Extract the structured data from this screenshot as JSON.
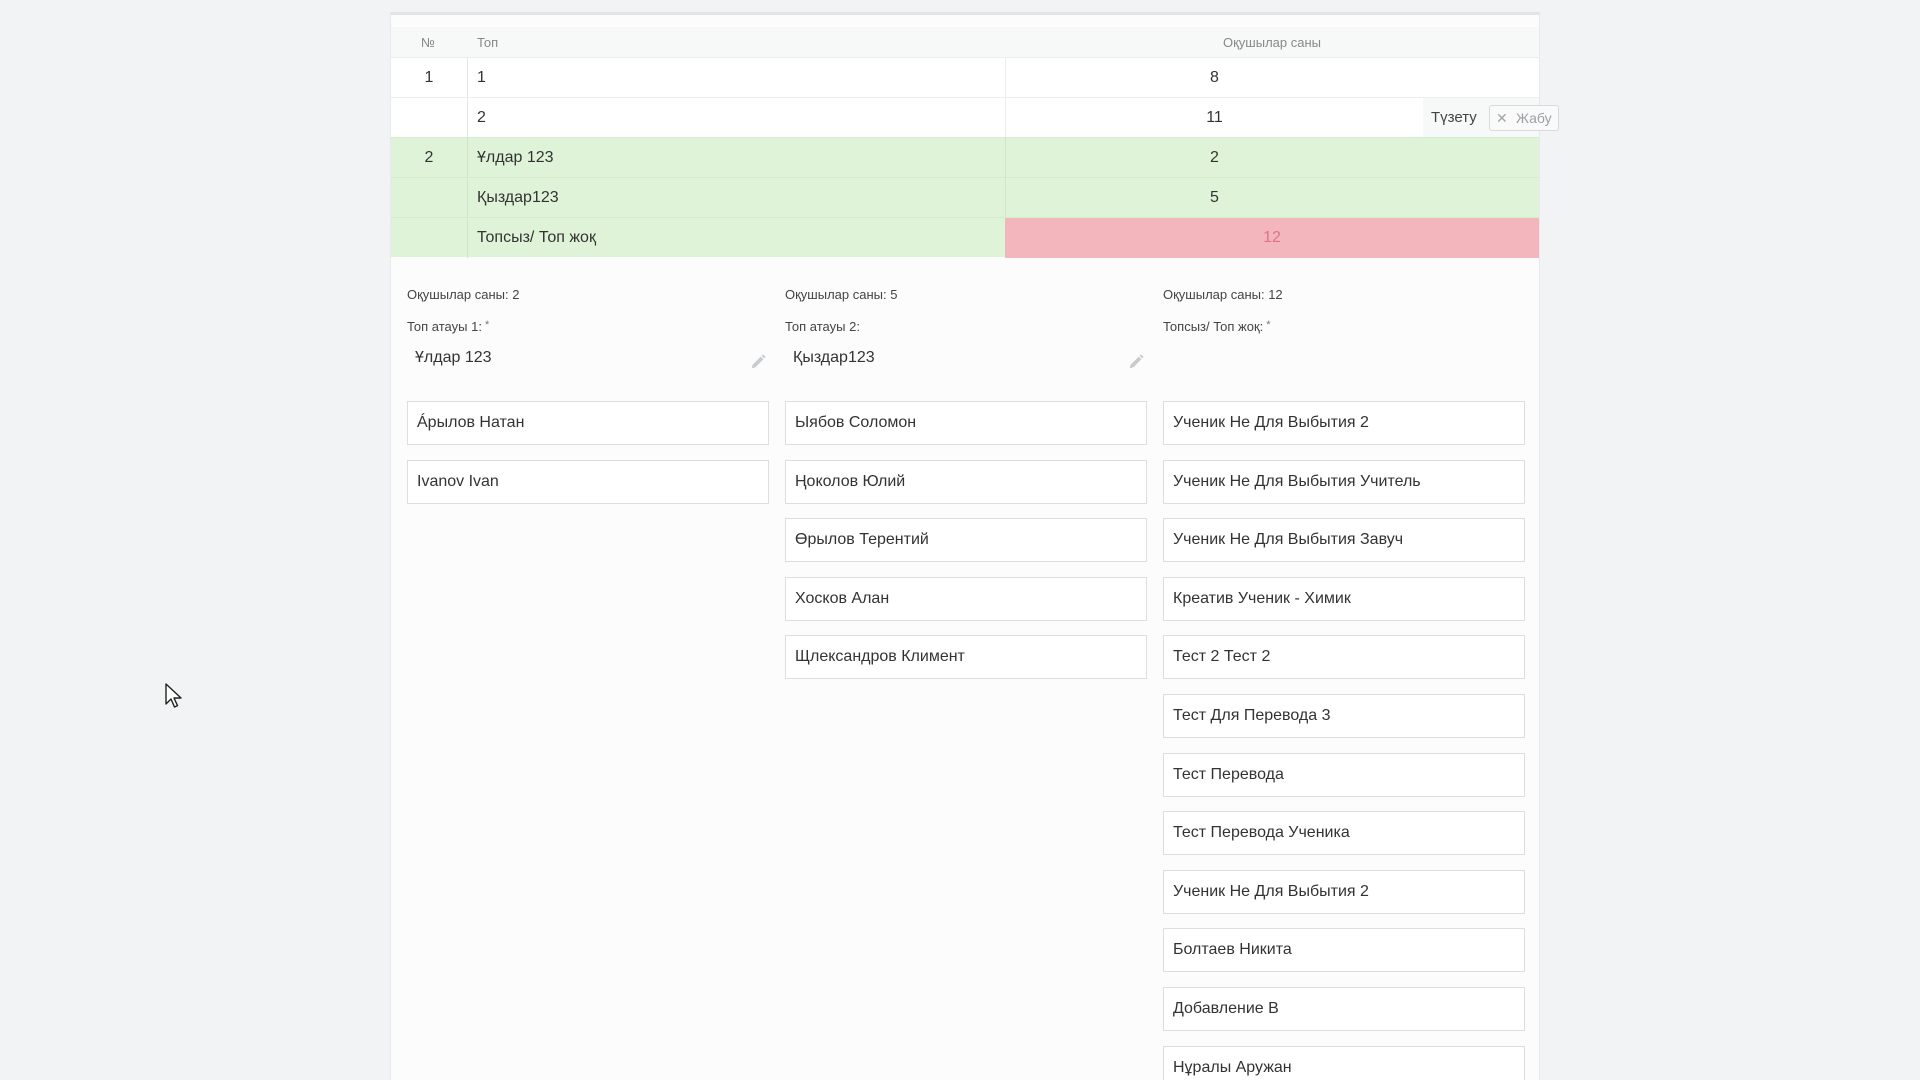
{
  "table": {
    "headers": {
      "num": "№",
      "group": "Топ",
      "count": "Оқушылар саны"
    },
    "rows": [
      {
        "num": "1",
        "group": "1",
        "count": "8"
      },
      {
        "num": "",
        "group": "2",
        "count": "11",
        "edit_label": "Түзету",
        "close_label": "Жабу"
      },
      {
        "num": "2",
        "group": "Ұлдар 123",
        "count": "2"
      },
      {
        "num": "",
        "group": "Қыздар123",
        "count": "5"
      },
      {
        "num": "",
        "group": "Топсыз/ Топ жоқ",
        "count": "12"
      }
    ]
  },
  "groups": [
    {
      "count_text": "Оқушылар саны: 2",
      "name_label": "Топ атауы 1:",
      "required_mark": "*",
      "name_value": "Ұлдар 123",
      "students": [
        "Áрылов Натан",
        "Ivanov Ivan"
      ]
    },
    {
      "count_text": "Оқушылар саны: 5",
      "name_label": "Топ атауы 2:",
      "name_value": "Қыздар123",
      "students": [
        "Ыябов Соломон",
        "Ңоколов Юлий",
        "Өрылов Терентий",
        "Хосков Алан",
        "Щлександров Климент"
      ]
    },
    {
      "count_text": "Оқушылар саны: 12",
      "name_label": "Топсыз/ Топ жоқ:",
      "required_mark": "*",
      "students": [
        "Ученик Не Для Выбытия 2",
        "Ученик Не Для Выбытия Учитель",
        "Ученик Не Для Выбытия Завуч",
        "Креатив Ученик - Химик",
        "Тест 2 Тест 2",
        "Тест Для Перевода 3",
        "Тест Перевода",
        "Тест Перевода Ученика",
        "Ученик Не Для Выбытия 2",
        "Болтаев Никита",
        "Добавление В",
        "Нұралы Аружан"
      ]
    }
  ],
  "icons": {
    "pencil": "pencil-icon",
    "close": "close-icon",
    "cursor": "mouse-cursor-icon"
  },
  "colors": {
    "highlight_green": "#dff3d8",
    "alert_red": "#f4b6bd"
  }
}
